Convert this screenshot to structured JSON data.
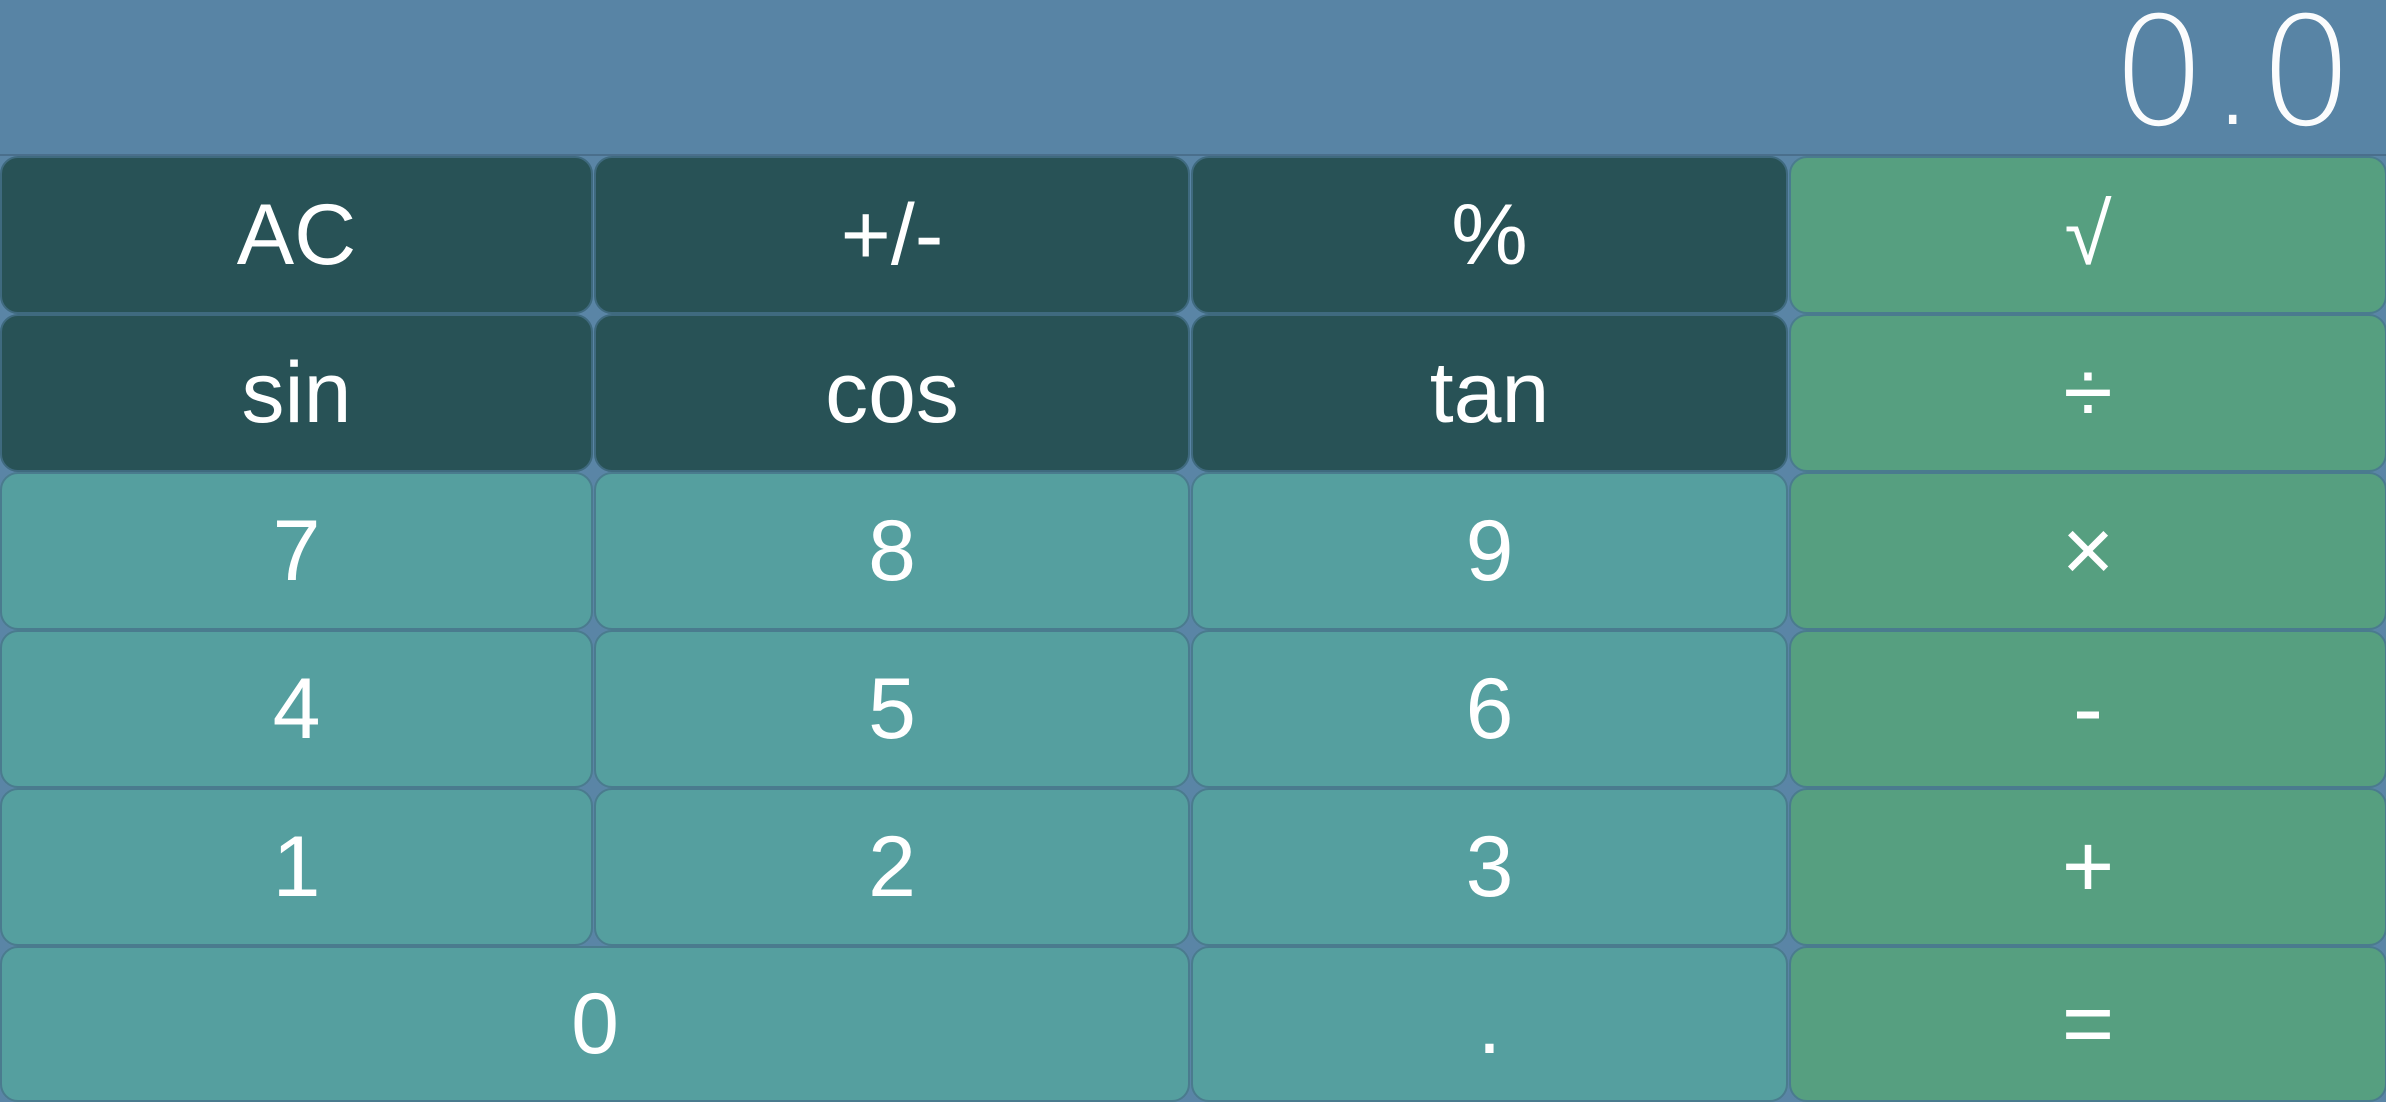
{
  "display": {
    "value": "0.0"
  },
  "keys": {
    "ac": "AC",
    "plus_minus": "+/-",
    "percent": "%",
    "sqrt": "√",
    "sin": "sin",
    "cos": "cos",
    "tan": "tan",
    "divide": "÷",
    "seven": "7",
    "eight": "8",
    "nine": "9",
    "multiply": "×",
    "four": "4",
    "five": "5",
    "six": "6",
    "minus": "-",
    "one": "1",
    "two": "2",
    "three": "3",
    "plus": "+",
    "zero": "0",
    "decimal": ".",
    "equals": "="
  },
  "colors": {
    "background": "#5a85a6",
    "function_key": "#285256",
    "number_key": "#559f9f",
    "operator_key": "#569f80",
    "text": "#ffffff"
  }
}
